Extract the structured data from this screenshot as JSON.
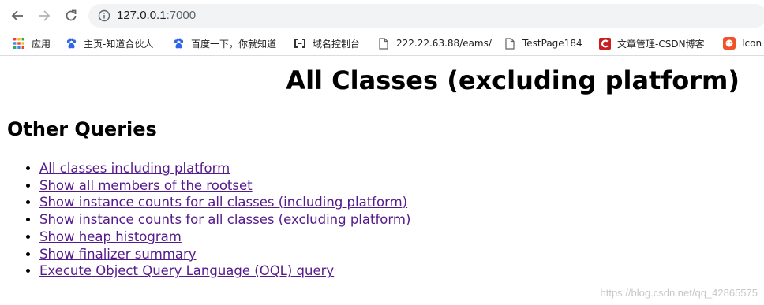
{
  "browser": {
    "url_host": "127.0.0.1",
    "url_port": ":7000",
    "bookmarks": [
      {
        "label": "应用",
        "icon": "apps-grid-icon"
      },
      {
        "label": "主页-知道合伙人",
        "icon": "baidu-paw-icon"
      },
      {
        "label": "百度一下，你就知道",
        "icon": "baidu-paw-icon"
      },
      {
        "label": "域名控制台",
        "icon": "cloud-console-icon"
      },
      {
        "label": "222.22.63.88/eams/",
        "icon": "page-icon"
      },
      {
        "label": "TestPage184",
        "icon": "page-icon"
      },
      {
        "label": "文章管理-CSDN博客",
        "icon": "csdn-icon"
      },
      {
        "label": "Icon",
        "icon": "iconfont-icon"
      }
    ]
  },
  "page": {
    "title": "All Classes (excluding platform)",
    "section_title": "Other Queries",
    "links": [
      "All classes including platform",
      "Show all members of the rootset",
      "Show instance counts for all classes (including platform)",
      "Show instance counts for all classes (excluding platform)",
      "Show heap histogram",
      "Show finalizer summary",
      "Execute Object Query Language (OQL) query"
    ]
  },
  "watermark": "https://blog.csdn.net/qq_42865575",
  "colors": {
    "link_visited": "#551a8b",
    "omnibox_bg": "#f1f3f4",
    "csdn_red": "#c81e1e",
    "iconfont_orange": "#f0522b",
    "baidu_blue": "#2f65e6"
  }
}
